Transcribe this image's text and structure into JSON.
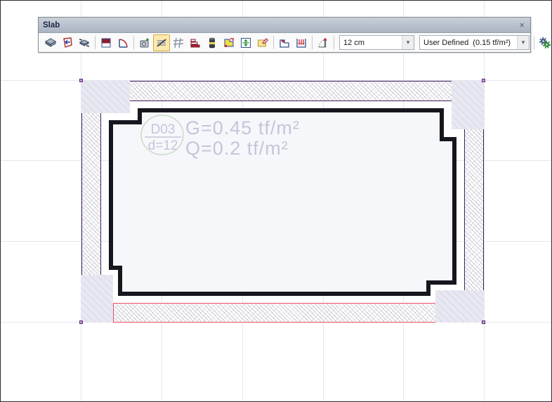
{
  "window": {
    "title": "Slab",
    "close": "×"
  },
  "toolbar": {
    "thickness_value": "12 cm",
    "load_value": "User Defined  (0.15 tf/m²)",
    "dropdown_arrow": "▾",
    "selected_icon": "hatch-display",
    "icons": [
      "new-slab",
      "import-polygon",
      "match-properties",
      "half-section",
      "arc-edge",
      "stamp-properties",
      "hatch-display",
      "mesh-display",
      "step-section",
      "column-light",
      "edit-region",
      "span-direction",
      "erase-region",
      "drop-panel",
      "area-load",
      "slope-angle",
      "settings-gears"
    ]
  },
  "drawing": {
    "slab_id": "D03",
    "thickness": "d=12",
    "dead_load": "G=0.45 tf/m²",
    "live_load": "Q=0.2 tf/m²"
  },
  "colors": {
    "wall_outline": "#44215f",
    "selected_wall_outline": "#ef5066",
    "slab_outline": "#16161f",
    "slab_fill": "#f6f7fa",
    "column_fill": "#e8e8f2",
    "label_text": "#c5c5db",
    "circle_stroke": "#c8dcc8",
    "handle": "#8a3fae",
    "selected_button_bg": "#fde8ad"
  }
}
